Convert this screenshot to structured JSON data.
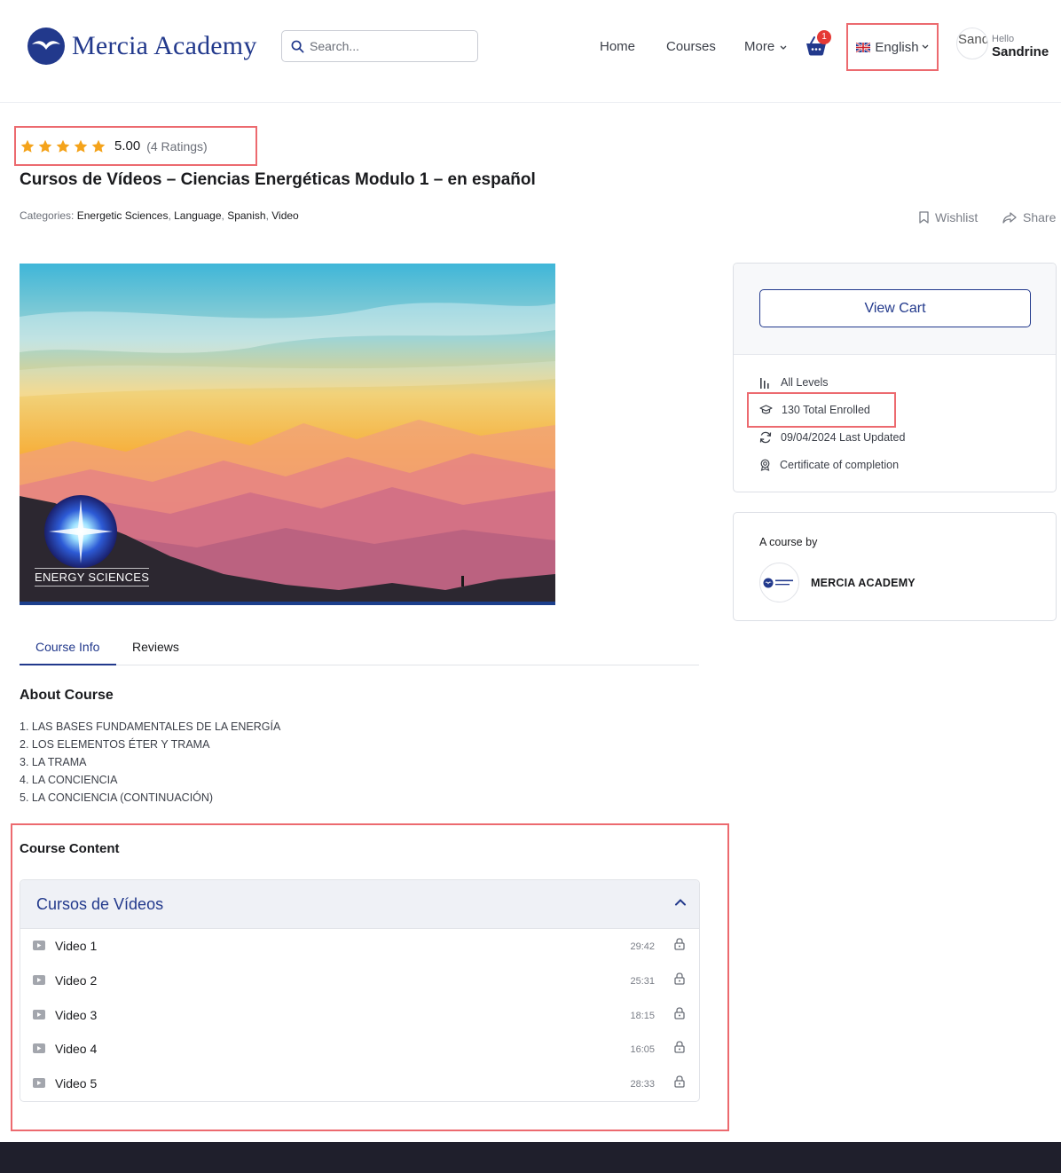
{
  "header": {
    "logo_text": "Mercia Academy",
    "search_placeholder": "Search...",
    "nav": {
      "home": "Home",
      "courses": "Courses",
      "more": "More"
    },
    "cart_count": "1",
    "language": "English",
    "avatar_text": "Sand",
    "hello": "Hello",
    "user_name": "Sandrine"
  },
  "course": {
    "rating_value": "5.00",
    "rating_count": "(4 Ratings)",
    "rating_stars": 5,
    "title": "Cursos de Vídeos – Ciencias Energéticas Modulo 1 – en español",
    "categories_label": "Categories:",
    "categories": [
      "Energetic Sciences",
      "Language",
      "Spanish",
      "Video"
    ],
    "wishlist": "Wishlist",
    "share": "Share",
    "thumbnail_text": "ENERGY SCIENCES"
  },
  "tabs": {
    "course_info": "Course Info",
    "reviews": "Reviews"
  },
  "about": {
    "title": "About Course",
    "items": [
      "1. LAS BASES FUNDAMENTALES DE LA ENERGÍA",
      "2. LOS ELEMENTOS ÉTER Y TRAMA",
      "3. LA TRAMA",
      "4. LA CONCIENCIA",
      "5. LA CONCIENCIA (CONTINUACIÓN)"
    ]
  },
  "content": {
    "title": "Course Content",
    "topic_title": "Cursos de Vídeos",
    "lessons": [
      {
        "name": "Video 1",
        "duration": "29:42"
      },
      {
        "name": "Video 2",
        "duration": "25:31"
      },
      {
        "name": "Video 3",
        "duration": "18:15"
      },
      {
        "name": "Video 4",
        "duration": "16:05"
      },
      {
        "name": "Video 5",
        "duration": "28:33"
      }
    ]
  },
  "sidebar": {
    "view_cart": "View Cart",
    "level": "All Levels",
    "enrolled": "130 Total Enrolled",
    "updated": "09/04/2024 Last Updated",
    "certificate": "Certificate of completion",
    "byline": "A course by",
    "instructor": "MERCIA ACADEMY"
  },
  "colors": {
    "brand": "#22398c",
    "star": "#f4a31b",
    "highlight": "#ec6a6f",
    "footer": "#1f1f2c"
  }
}
